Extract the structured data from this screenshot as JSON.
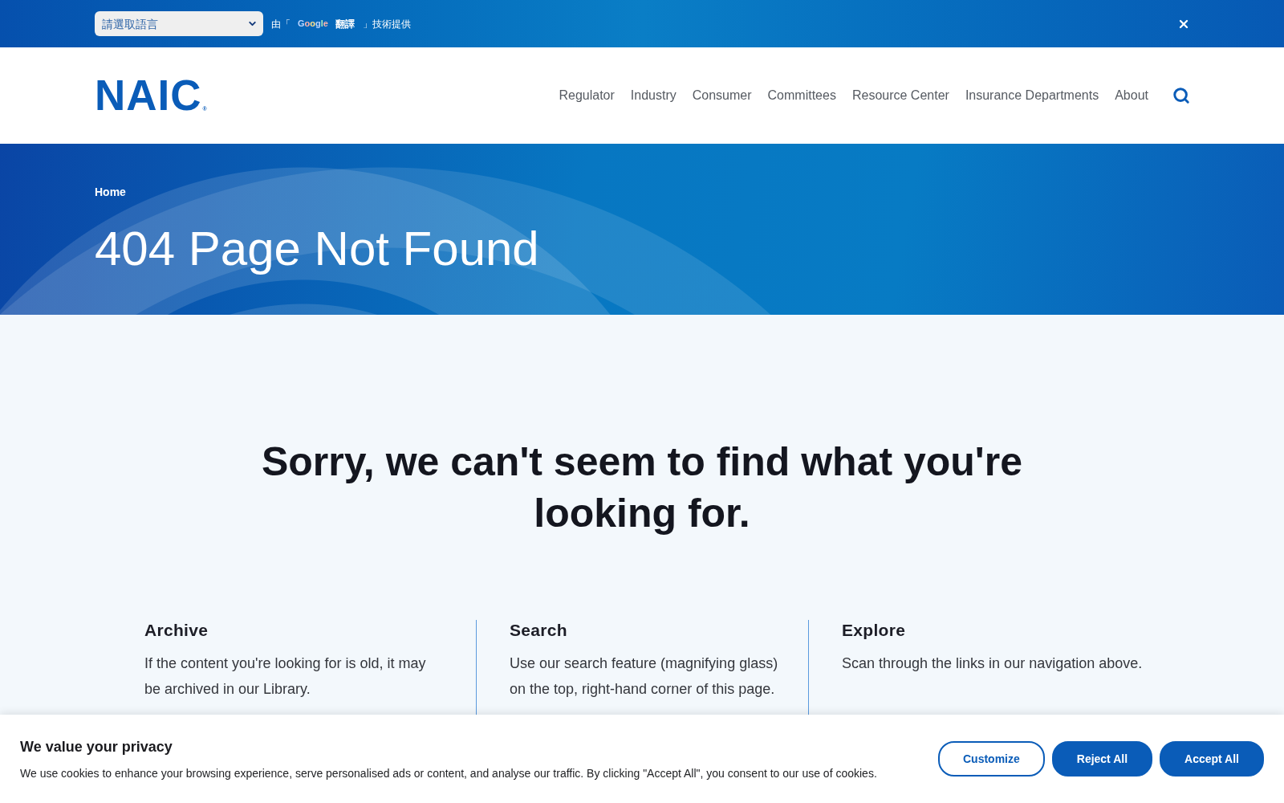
{
  "translate_bar": {
    "language_select": {
      "value": "請選取語言"
    },
    "credit": [
      {
        "kind": "text",
        "text": "由「"
      },
      {
        "kind": "google_logo",
        "text": "Google"
      },
      {
        "kind": "brand",
        "text": "翻譯"
      },
      {
        "kind": "text",
        "text": "」技術提供"
      }
    ]
  },
  "header": {
    "logo": {
      "text": "NAIC",
      "mark": "®"
    },
    "nav": [
      "Regulator",
      "Industry",
      "Consumer",
      "Committees",
      "Resource Center",
      "Insurance Departments",
      "About"
    ]
  },
  "hero": {
    "breadcrumb": [
      "Home"
    ],
    "title": "404 Page Not Found"
  },
  "main": {
    "heading": "Sorry, we can't seem to find what you're looking for.",
    "columns": [
      {
        "title": "Archive",
        "text": "If the content you're looking for is old, it may be archived in our Library."
      },
      {
        "title": "Search",
        "text": "Use our search feature (magnifying glass) on the top, right-hand corner of this page."
      },
      {
        "title": "Explore",
        "text": "Scan through the links in our navigation above."
      }
    ]
  },
  "cookie_banner": {
    "title": "We value your privacy",
    "text": "We use cookies to enhance your browsing experience, serve personalised ads or content, and analyse our traffic. By clicking \"Accept All\", you consent to our use of cookies.",
    "buttons": [
      {
        "label": "Customize",
        "kind": "outline"
      },
      {
        "label": "Reject All",
        "kind": "solid"
      },
      {
        "label": "Accept All",
        "kind": "solid"
      }
    ]
  }
}
